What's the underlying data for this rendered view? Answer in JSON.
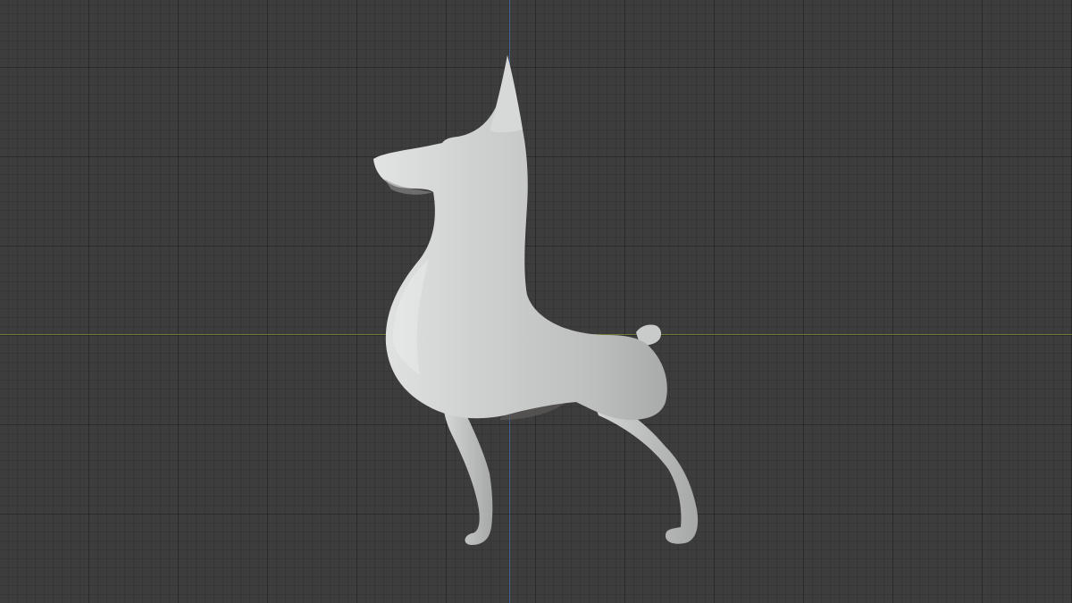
{
  "viewport": {
    "background_color": "#3d3d3d",
    "axis_x_color": "#6e7c39",
    "axis_y_color": "#3f6490",
    "grid": true
  },
  "model": {
    "icon": "doberman-sculpt-icon",
    "material_color": "#c8c9c9"
  }
}
